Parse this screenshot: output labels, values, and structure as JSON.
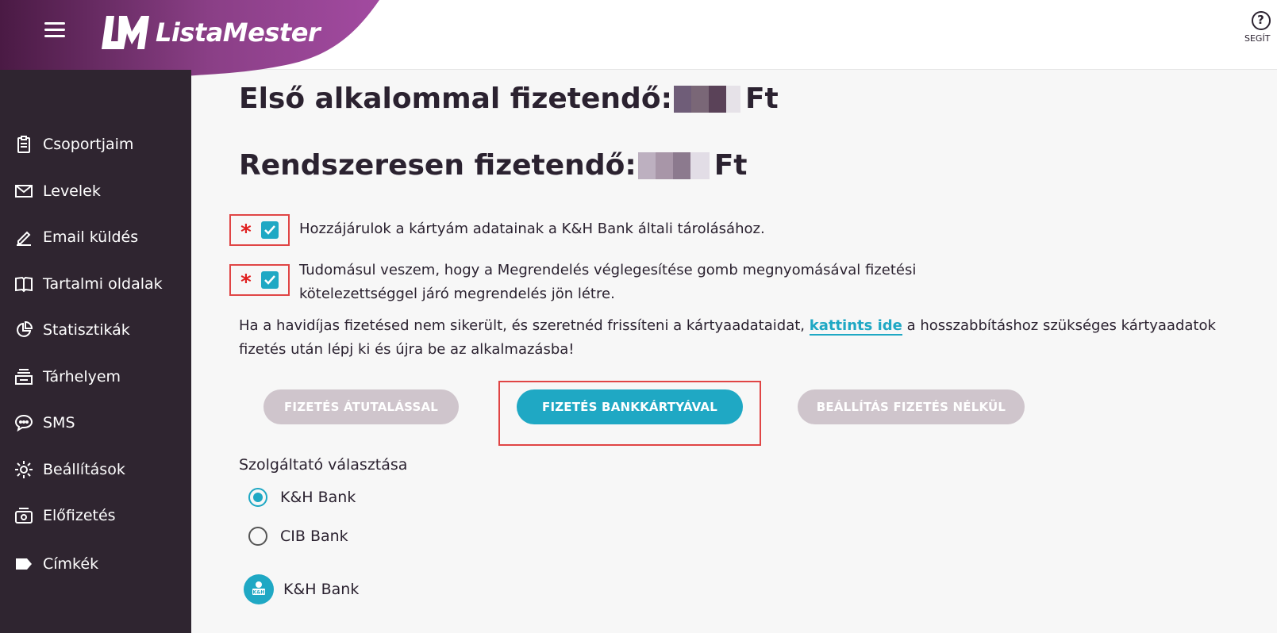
{
  "header": {
    "brand": "ListaMester",
    "help_label": "SEGÍT",
    "menu_icon": "hamburger-icon",
    "brand_color": "#8a3f86"
  },
  "sidebar": {
    "items": [
      {
        "label": "Csoportjaim",
        "icon": "clipboard-icon"
      },
      {
        "label": "Levelek",
        "icon": "envelope-icon"
      },
      {
        "label": "Email küldés",
        "icon": "pencil-icon"
      },
      {
        "label": "Tartalmi oldalak",
        "icon": "book-icon"
      },
      {
        "label": "Statisztikák",
        "icon": "pie-chart-icon"
      },
      {
        "label": "Tárhelyem",
        "icon": "storage-icon"
      },
      {
        "label": "SMS",
        "icon": "chat-bubble-icon"
      },
      {
        "label": "Beállítások",
        "icon": "gear-icon"
      },
      {
        "label": "Előfizetés",
        "icon": "subscription-icon"
      },
      {
        "label": "Címkék",
        "icon": "tag-icon"
      }
    ]
  },
  "main": {
    "first_payment_label": "Első alkalommal fizetendő:",
    "recurring_payment_label": "Rendszeresen fizetendő:",
    "currency": "Ft",
    "consents": [
      {
        "text": "Hozzájárulok a kártyám adatainak a K&H Bank általi tárolásához.",
        "checked": true,
        "required_mark": "*"
      },
      {
        "text": "Tudomásul veszem, hogy a Megrendelés véglegesítése gomb megnyomásával fizetési kötelezettséggel járó megrendelés jön létre.",
        "checked": true,
        "required_mark": "*"
      }
    ],
    "info_before": "Ha a havidíjas fizetésed nem sikerült, és szeretnéd frissíteni a kártyaadataidat, ",
    "info_link": "kattints ide",
    "info_after_line1": " a hosszabbításhoz szükséges kártyaadatok",
    "info_line2": "fizetés után lépj ki és újra be az alkalmazásba!",
    "buttons": {
      "transfer": "FIZETÉS ÁTUTALÁSSAL",
      "card": "FIZETÉS BANKKÁRTYÁVAL",
      "no_payment": "BEÁLLÍTÁS FIZETÉS NÉLKÜL"
    },
    "provider_label": "Szolgáltató választása",
    "providers": [
      {
        "label": "K&H Bank",
        "selected": true
      },
      {
        "label": "CIB Bank",
        "selected": false
      }
    ],
    "selected_bank_label": "K&H Bank",
    "selected_bank_logo_text": "K&H",
    "accent_color": "#1fa8c4"
  }
}
